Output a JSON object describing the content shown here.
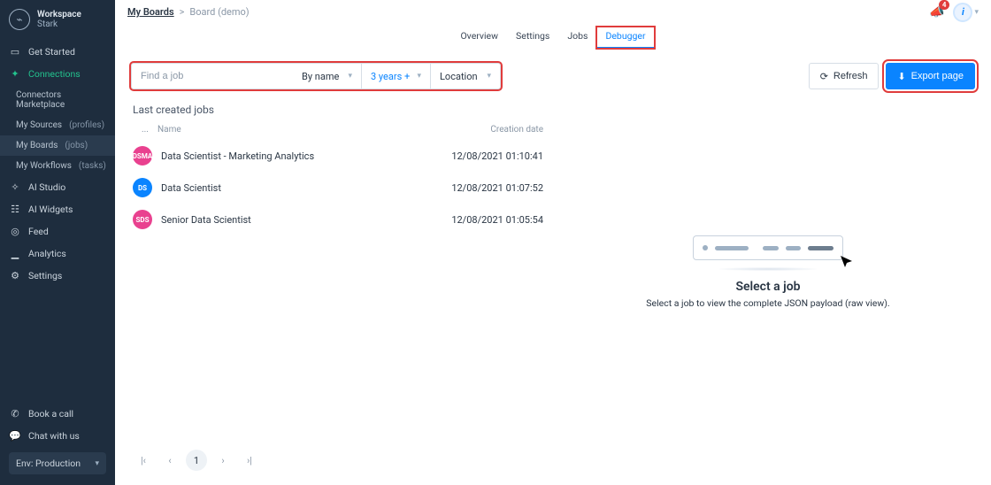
{
  "workspace": {
    "label": "Workspace",
    "name": "Stark"
  },
  "sidebar": {
    "get_started": "Get Started",
    "connections": "Connections",
    "subs": [
      {
        "label": "Connectors Marketplace",
        "paren": ""
      },
      {
        "label": "My Sources",
        "paren": " (profiles)"
      },
      {
        "label": "My Boards",
        "paren": " (jobs)"
      },
      {
        "label": "My Workflows",
        "paren": " (tasks)"
      }
    ],
    "ai_studio": "AI Studio",
    "ai_widgets": "AI Widgets",
    "feed": "Feed",
    "analytics": "Analytics",
    "settings": "Settings",
    "book_call": "Book a call",
    "chat": "Chat with us",
    "env": "Env: Production"
  },
  "breadcrumb": {
    "root": "My Boards",
    "sep": ">",
    "current": "Board (demo)"
  },
  "notifications": {
    "count": "4"
  },
  "tabs": [
    "Overview",
    "Settings",
    "Jobs",
    "Debugger"
  ],
  "filters": {
    "search_placeholder": "Find a job",
    "sort_label": "By name",
    "range_label": "3 years +",
    "location_label": "Location"
  },
  "buttons": {
    "refresh": "Refresh",
    "export": "Export page"
  },
  "jobs": {
    "title": "Last created jobs",
    "cols": {
      "idx": "...",
      "name": "Name",
      "date": "Creation date"
    },
    "rows": [
      {
        "badge": "DSMA",
        "color": "#e9418f",
        "name": "Data Scientist - Marketing Analytics",
        "date": "12/08/2021 01:10:41"
      },
      {
        "badge": "DS",
        "color": "#0a84ff",
        "name": "Data Scientist",
        "date": "12/08/2021 01:07:52"
      },
      {
        "badge": "SDS",
        "color": "#e9418f",
        "name": "Senior Data Scientist",
        "date": "12/08/2021 01:05:54"
      }
    ]
  },
  "placeholder": {
    "title": "Select a job",
    "sub": "Select a job to view the complete JSON payload (raw view)."
  },
  "pager": {
    "current": "1"
  }
}
